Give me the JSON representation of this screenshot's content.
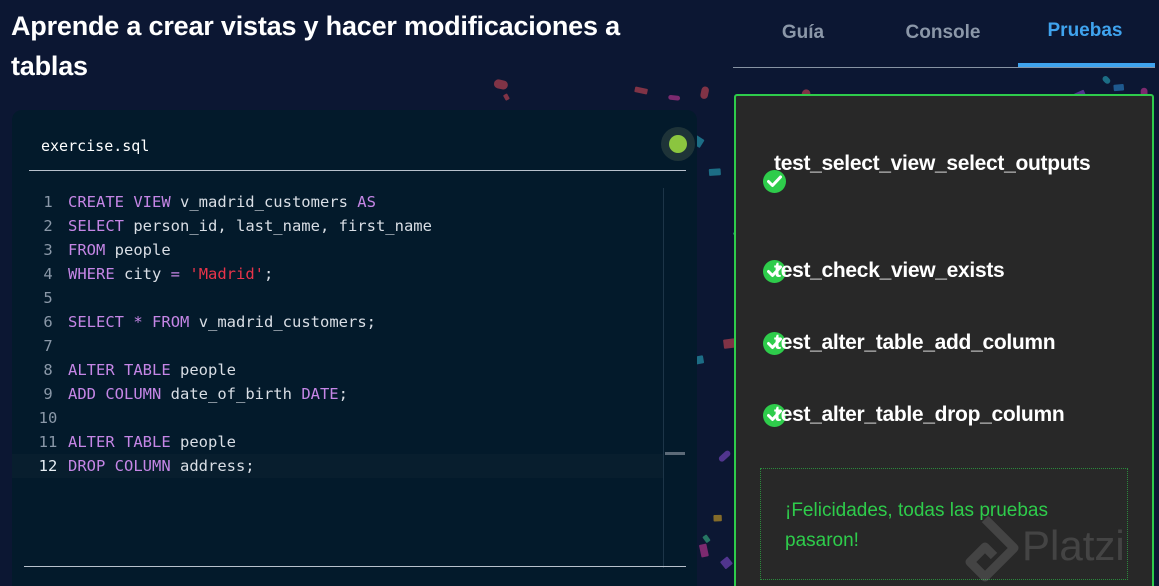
{
  "page": {
    "title": "Aprende a crear vistas y hacer modificaciones a tablas"
  },
  "editor": {
    "file_name": "exercise.sql",
    "status": "success",
    "status_color": "#8bc53f",
    "active_line": 12,
    "lines": [
      {
        "n": "1",
        "tokens": [
          {
            "t": "CREATE VIEW",
            "k": "kw"
          },
          {
            "t": " v_madrid_customers ",
            "k": ""
          },
          {
            "t": "AS",
            "k": "kw"
          }
        ]
      },
      {
        "n": "2",
        "tokens": [
          {
            "t": "SELECT",
            "k": "kw"
          },
          {
            "t": " person_id, last_name, first_name",
            "k": ""
          }
        ]
      },
      {
        "n": "3",
        "tokens": [
          {
            "t": "FROM",
            "k": "kw"
          },
          {
            "t": " people",
            "k": ""
          }
        ]
      },
      {
        "n": "4",
        "tokens": [
          {
            "t": "WHERE",
            "k": "kw"
          },
          {
            "t": " city ",
            "k": ""
          },
          {
            "t": "=",
            "k": "kw"
          },
          {
            "t": " ",
            "k": ""
          },
          {
            "t": "'Madrid'",
            "k": "str"
          },
          {
            "t": ";",
            "k": ""
          }
        ]
      },
      {
        "n": "5",
        "tokens": []
      },
      {
        "n": "6",
        "tokens": [
          {
            "t": "SELECT",
            "k": "kw"
          },
          {
            "t": " ",
            "k": ""
          },
          {
            "t": "*",
            "k": "kw"
          },
          {
            "t": " ",
            "k": ""
          },
          {
            "t": "FROM",
            "k": "kw"
          },
          {
            "t": " v_madrid_customers;",
            "k": ""
          }
        ]
      },
      {
        "n": "7",
        "tokens": []
      },
      {
        "n": "8",
        "tokens": [
          {
            "t": "ALTER TABLE",
            "k": "kw"
          },
          {
            "t": " people",
            "k": ""
          }
        ]
      },
      {
        "n": "9",
        "tokens": [
          {
            "t": "ADD COLUMN",
            "k": "kw"
          },
          {
            "t": " date_of_birth ",
            "k": ""
          },
          {
            "t": "DATE",
            "k": "kw"
          },
          {
            "t": ";",
            "k": ""
          }
        ]
      },
      {
        "n": "10",
        "tokens": []
      },
      {
        "n": "11",
        "tokens": [
          {
            "t": "ALTER TABLE",
            "k": "kw"
          },
          {
            "t": " people",
            "k": ""
          }
        ]
      },
      {
        "n": "12",
        "tokens": [
          {
            "t": "DROP COLUMN",
            "k": "kw"
          },
          {
            "t": " address;",
            "k": ""
          }
        ]
      }
    ]
  },
  "tabs": [
    {
      "label": "Guía",
      "active": false
    },
    {
      "label": "Console",
      "active": false
    },
    {
      "label": "Pruebas",
      "active": true
    }
  ],
  "results": {
    "tests": [
      {
        "name": "test_select_view_select_outputs",
        "status": "passed"
      },
      {
        "name": "test_check_view_exists",
        "status": "passed"
      },
      {
        "name": "test_alter_table_add_column",
        "status": "passed"
      },
      {
        "name": "test_alter_table_drop_column",
        "status": "passed"
      }
    ],
    "message": "¡Felicidades, todas las pruebas pasaron!",
    "success_color": "#2ecc4b"
  },
  "colors": {
    "background": "#0c1733",
    "accent": "#3fa3ee",
    "keyword": "#c586e6",
    "string": "#e8344a"
  },
  "watermark": {
    "text": "Platzi"
  }
}
